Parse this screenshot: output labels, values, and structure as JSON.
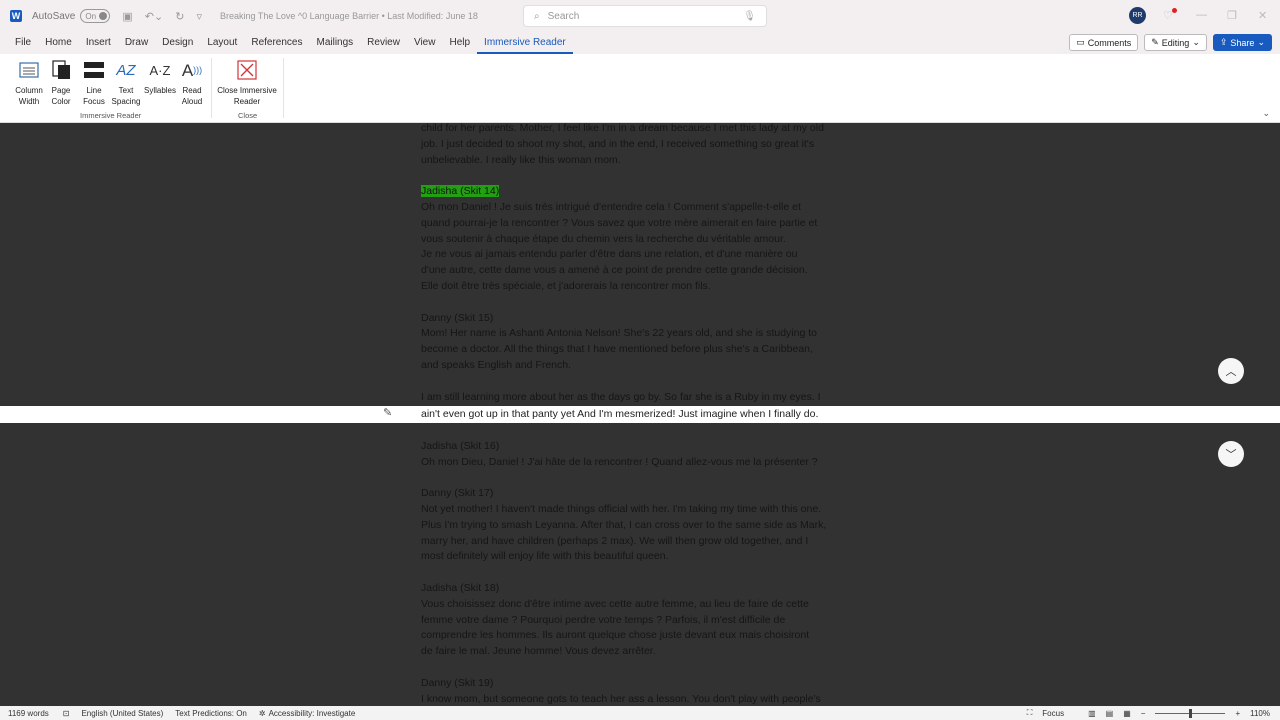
{
  "titlebar": {
    "app_letter": "W",
    "autosave_label": "AutoSave",
    "autosave_state": "On",
    "doc_title": "Breaking The Love ^0 Language Barrier • Last Modified: June 18",
    "search_placeholder": "Search",
    "avatar_initials": "RR"
  },
  "menu": {
    "items": [
      "File",
      "Home",
      "Insert",
      "Draw",
      "Design",
      "Layout",
      "References",
      "Mailings",
      "Review",
      "View",
      "Help",
      "Immersive Reader"
    ],
    "comments": "Comments",
    "editing": "Editing",
    "share": "Share"
  },
  "ribbon": {
    "buttons": [
      {
        "label1": "Column",
        "label2": "Width"
      },
      {
        "label1": "Page",
        "label2": "Color"
      },
      {
        "label1": "Line",
        "label2": "Focus"
      },
      {
        "label1": "Text",
        "label2": "Spacing"
      },
      {
        "label1": "Syllables",
        "label2": ""
      },
      {
        "label1": "Read",
        "label2": "Aloud"
      },
      {
        "label1": "Close Immersive",
        "label2": "Reader"
      }
    ],
    "group_immersive": "Immersive Reader",
    "group_close": "Close"
  },
  "document": {
    "lines_top": [
      "child for her parents. Mother, I feel like I'm in a dream because I met this lady at my old",
      "job. I just decided to shoot my shot, and in the end, I received something so great it's",
      "unbelievable. I really like this woman mom.",
      "",
      "Jadisha (Skit 14)",
      "Oh mon Daniel ! Je suis très intrigué d'entendre cela ! Comment s'appelle-t-elle et",
      "quand pourrai-je la rencontrer ? Vous savez que votre mère aimerait en faire partie et",
      "vous soutenir à chaque étape du chemin vers la recherche du véritable amour.",
      " Je ne vous ai jamais entendu parler d'être dans une relation, et d'une manière ou",
      "d'une autre, cette dame vous a amené à ce point de prendre cette grande décision.",
      "Elle doit être très spéciale, et j'adorerais la rencontrer mon fils.",
      "",
      "Danny (Skit 15)",
      "Mom! Her name is Ashanti Antonia Nelson! She's 22 years old, and she is studying to",
      "become a doctor. All the things that I have mentioned before plus she's a Caribbean,",
      "and speaks English and French.",
      "",
      "I am still learning more about her as the days go by. So far she is a Ruby in my eyes. I"
    ],
    "focus_line": "ain't even got up in that panty yet And I'm mesmerized! Just imagine when I finally do.",
    "lines_bottom": [
      "",
      "Jadisha (Skit 16)",
      "Oh mon Dieu, Daniel ! J'ai hâte de la rencontrer ! Quand allez-vous me la présenter ?",
      "",
      "Danny (Skit 17)",
      "Not yet mother! I haven't made things official with her. I'm taking my time with this one.",
      "Plus I'm trying to smash Leyanna. After that, I can cross over to the same side as Mark,",
      "marry her, and have children (perhaps 2 max). We will then grow old together, and I",
      "most definitely will enjoy life with this beautiful queen.",
      "",
      "Jadisha (Skit 18)",
      "Vous choisissez donc d'être intime avec cette autre femme, au lieu de faire de cette",
      "femme votre dame ? Pourquoi perdre votre temps ? Parfois, il m'est difficile de",
      "comprendre les hommes. Ils auront quelque chose juste devant eux mais choisiront",
      "de faire le mal. Jeune homme!  Vous devez arrêter.",
      "",
      "Danny (Skit 19)",
      "I know mom, but someone gots to teach her ass a lesson. You don't play with people's"
    ]
  },
  "statusbar": {
    "words": "1169 words",
    "language": "English (United States)",
    "predictions": "Text Predictions: On",
    "accessibility": "Accessibility: Investigate",
    "focus": "Focus",
    "zoom": "110%"
  },
  "colors": {
    "accent": "#185abd",
    "page_color_dark": "#323232",
    "highlight_green": "#22a012"
  }
}
